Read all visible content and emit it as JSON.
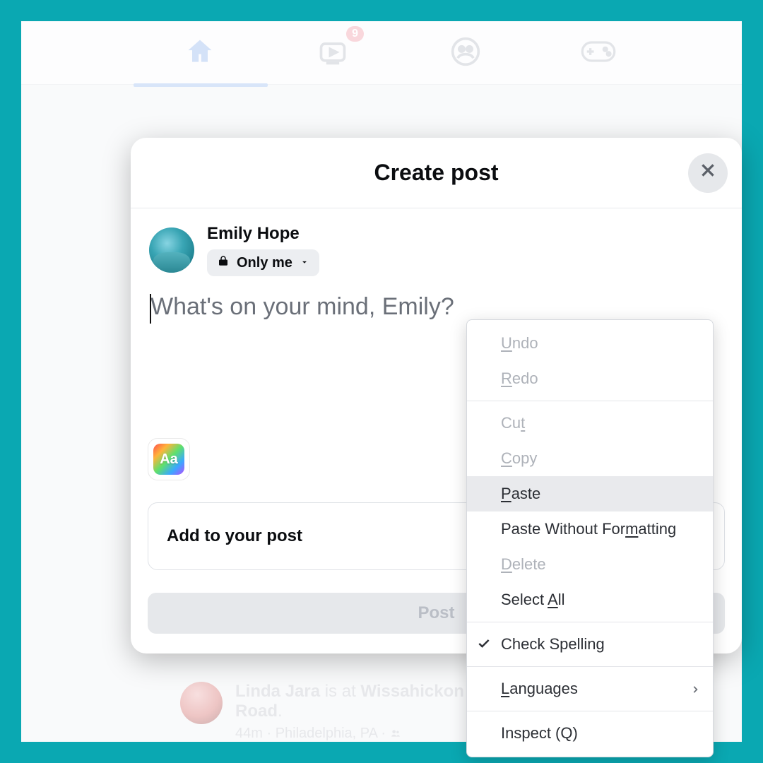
{
  "nav": {
    "badge_count": "9"
  },
  "modal": {
    "title": "Create post",
    "user_name": "Emily Hope",
    "audience_label": "Only me",
    "placeholder": "What's on your mind, Emily?",
    "color_picker_label": "Aa",
    "add_label": "Add to your post",
    "post_label": "Post"
  },
  "feed": {
    "author": "Linda Jara",
    "connector": " is at ",
    "place": "Wissahickon C",
    "place2": "Road",
    "meta_time": "44m",
    "meta_sep": " · ",
    "meta_location": "Philadelphia, PA",
    "meta_dot": " · "
  },
  "context_menu": {
    "undo": {
      "pre": "",
      "u": "U",
      "post": "ndo"
    },
    "redo": {
      "pre": "",
      "u": "R",
      "post": "edo"
    },
    "cut": {
      "pre": "Cu",
      "u": "t",
      "post": ""
    },
    "copy": {
      "pre": "",
      "u": "C",
      "post": "opy"
    },
    "paste": {
      "pre": "",
      "u": "P",
      "post": "aste"
    },
    "paste_plain": {
      "pre": "Paste Without For",
      "u": "m",
      "post": "atting"
    },
    "delete": {
      "pre": "",
      "u": "D",
      "post": "elete"
    },
    "select_all": {
      "pre": "Select ",
      "u": "A",
      "post": "ll"
    },
    "spell": "Check Spelling",
    "languages": {
      "pre": "",
      "u": "L",
      "post": "anguages"
    },
    "inspect": "Inspect (Q)"
  }
}
